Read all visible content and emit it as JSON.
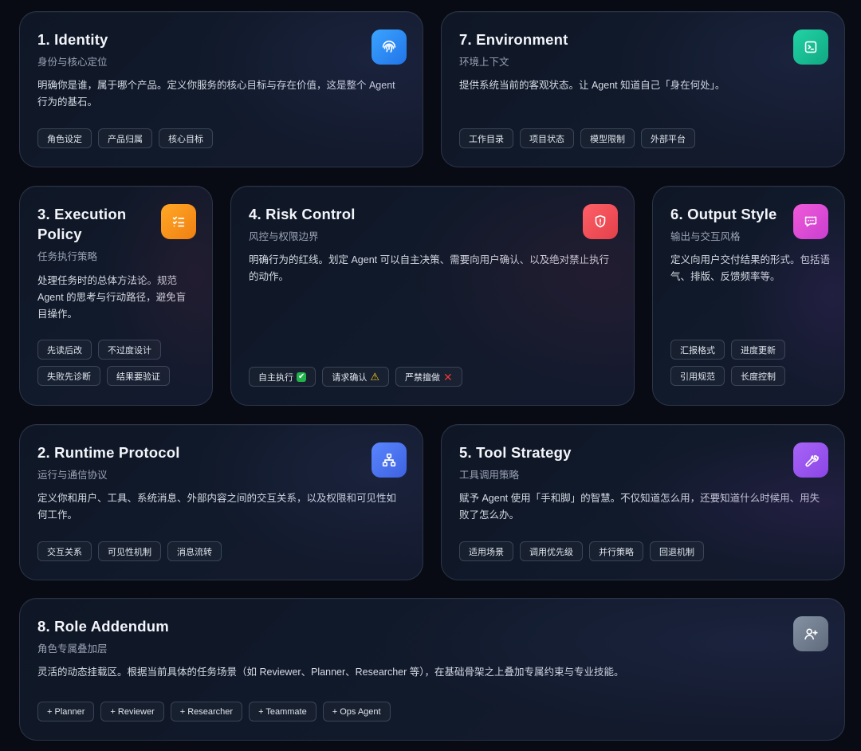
{
  "cards": {
    "identity": {
      "title": "1. Identity",
      "subtitle": "身份与核心定位",
      "desc": "明确你是谁，属于哪个产品。定义你服务的核心目标与存在价值，这是整个 Agent 行为的基石。",
      "icon": "fingerprint-icon",
      "color": "#2f8ff5",
      "tags": [
        "角色设定",
        "产品归属",
        "核心目标"
      ]
    },
    "environment": {
      "title": "7. Environment",
      "subtitle": "环境上下文",
      "desc": "提供系统当前的客观状态。让 Agent 知道自己「身在何处」。",
      "icon": "terminal-icon",
      "color": "#17bf95",
      "tags": [
        "工作目录",
        "项目状态",
        "模型限制",
        "外部平台"
      ]
    },
    "execution": {
      "title": "3. Execution Policy",
      "subtitle": "任务执行策略",
      "desc": "处理任务时的总体方法论。规范 Agent 的思考与行动路径，避免盲目操作。",
      "icon": "checklist-icon",
      "color": "#f7931a",
      "tags": [
        "先读后改",
        "不过度设计",
        "失败先诊断",
        "结果要验证"
      ]
    },
    "risk": {
      "title": "4. Risk Control",
      "subtitle": "风控与权限边界",
      "desc": "明确行为的红线。划定 Agent 可以自主决策、需要向用户确认、以及绝对禁止执行的动作。",
      "icon": "shield-alert-icon",
      "color": "#ef4f57",
      "tags": [
        "自主执行",
        "请求确认",
        "严禁擅做"
      ],
      "tag_icons": [
        "check-mark-emoji",
        "warning-emoji",
        "cross-mark-emoji"
      ]
    },
    "output": {
      "title": "6. Output Style",
      "subtitle": "输出与交互风格",
      "desc": "定义向用户交付结果的形式。包括语气、排版、反馈频率等。",
      "icon": "message-dots-icon",
      "color": "#e24fcf",
      "tags": [
        "汇报格式",
        "进度更新",
        "引用规范",
        "长度控制"
      ]
    },
    "runtime": {
      "title": "2. Runtime Protocol",
      "subtitle": "运行与通信协议",
      "desc": "定义你和用户、工具、系统消息、外部内容之间的交互关系，以及权限和可见性如何工作。",
      "icon": "network-icon",
      "color": "#4c74ee",
      "tags": [
        "交互关系",
        "可见性机制",
        "消息流转"
      ]
    },
    "tool": {
      "title": "5. Tool Strategy",
      "subtitle": "工具调用策略",
      "desc": "赋予 Agent 使用「手和脚」的智慧。不仅知道怎么用，还要知道什么时候用、用失败了怎么办。",
      "icon": "wrench-icon",
      "color": "#9b54ee",
      "tags": [
        "适用场景",
        "调用优先级",
        "并行策略",
        "回退机制"
      ]
    },
    "role": {
      "title": "8. Role Addendum",
      "subtitle": "角色专属叠加层",
      "desc": "灵活的动态挂载区。根据当前具体的任务场景（如 Reviewer、Planner、Researcher 等），在基础骨架之上叠加专属约束与专业技能。",
      "icon": "user-plus-icon",
      "color": "#6f7b8c",
      "tags": [
        "+ Planner",
        "+ Reviewer",
        "+ Researcher",
        "+ Teammate",
        "+ Ops Agent"
      ]
    }
  }
}
